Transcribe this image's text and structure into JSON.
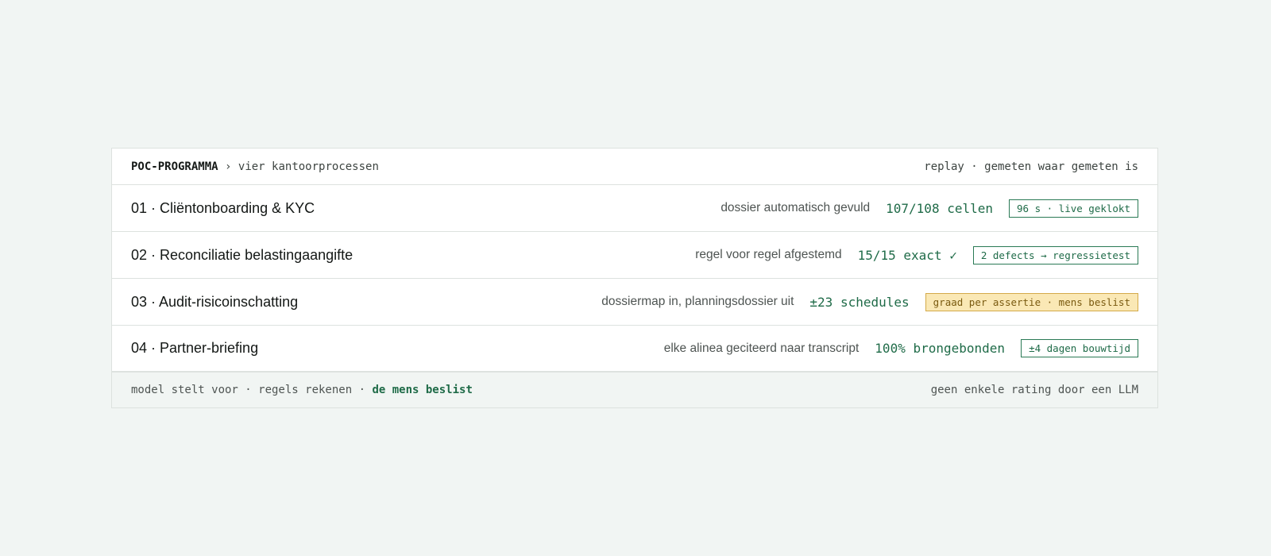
{
  "header": {
    "program": "POC-PROGRAMMA",
    "separator": "›",
    "subtitle": "vier kantoorprocessen",
    "note": "replay · gemeten waar gemeten is"
  },
  "rows": [
    {
      "title": "01 · Cliëntonboarding & KYC",
      "desc": "dossier automatisch gevuld",
      "metric": "107/108 cellen",
      "badge": "96 s · live geklokt",
      "badge_style": "outline"
    },
    {
      "title": "02 · Reconciliatie belastingaangifte",
      "desc": "regel voor regel afgestemd",
      "metric": "15/15 exact ✓",
      "badge": "2 defects → regressietest",
      "badge_style": "outline"
    },
    {
      "title": "03 · Audit-risicoinschatting",
      "desc": "dossiermap in, planningsdossier uit",
      "metric": "±23 schedules",
      "badge": "graad per assertie · mens beslist",
      "badge_style": "warning"
    },
    {
      "title": "04 · Partner-briefing",
      "desc": "elke alinea geciteerd naar transcript",
      "metric": "100% brongebonden",
      "badge": "±4 dagen bouwtijd",
      "badge_style": "outline"
    }
  ],
  "footer": {
    "left_plain": "model stelt voor · regels rekenen ·",
    "left_accent": "de mens beslist",
    "right": "geen enkele rating door een LLM"
  },
  "colors": {
    "background": "#f1f5f3",
    "accent_green": "#1f6b48",
    "warning_fill": "#fae8b5",
    "warning_border": "#d4aa4a"
  }
}
